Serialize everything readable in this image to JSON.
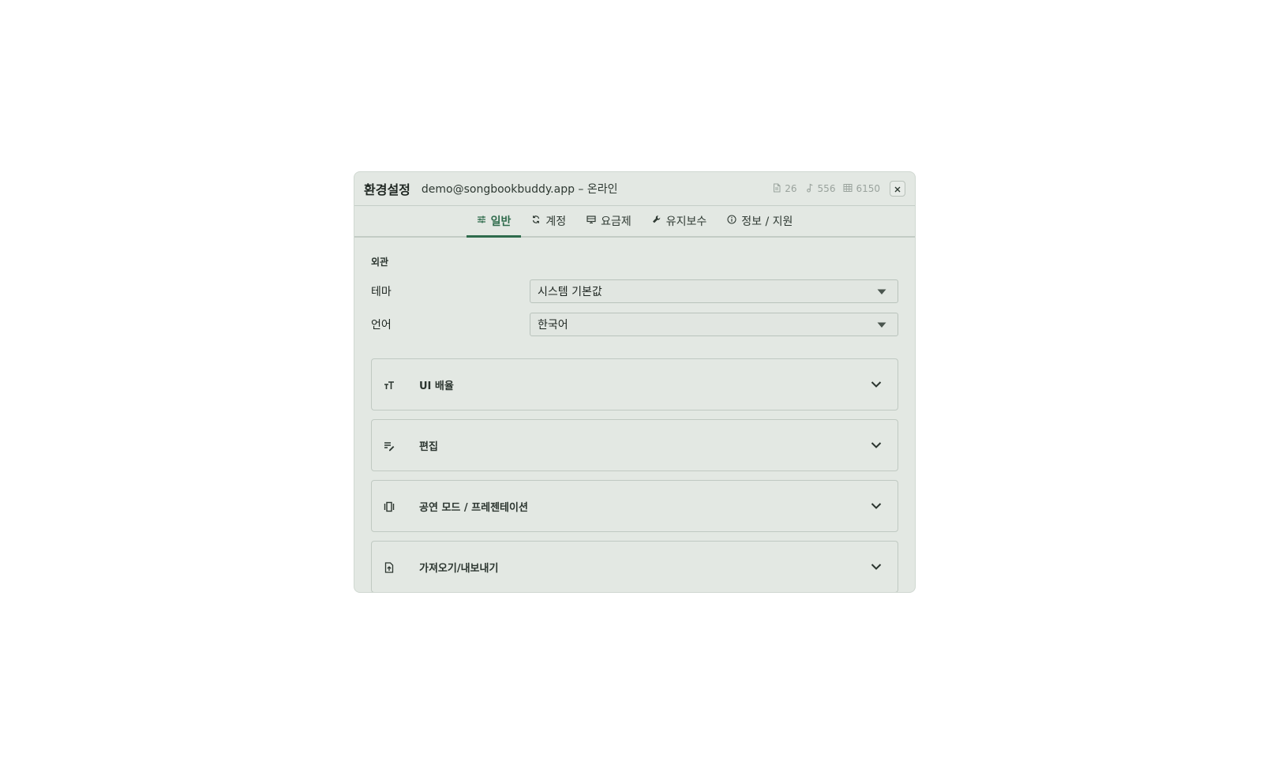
{
  "dialog": {
    "title": "환경설정",
    "subtitle": "demo@songbookbuddy.app – 온라인",
    "stats": [
      {
        "icon": "document-icon",
        "value": "26"
      },
      {
        "icon": "music-note-icon",
        "value": "556"
      },
      {
        "icon": "grid-icon",
        "value": "6150"
      }
    ]
  },
  "tabs": [
    {
      "label": "일반",
      "icon": "sliders-icon",
      "active": true
    },
    {
      "label": "계정",
      "icon": "sync-icon",
      "active": false
    },
    {
      "label": "요금제",
      "icon": "monitor-icon",
      "active": false
    },
    {
      "label": "유지보수",
      "icon": "wrench-icon",
      "active": false
    },
    {
      "label": "정보 / 지원",
      "icon": "info-icon",
      "active": false
    }
  ],
  "appearance": {
    "section_title": "외관",
    "theme_label": "테마",
    "theme_value": "시스템 기본값",
    "language_label": "언어",
    "language_value": "한국어"
  },
  "panels": [
    {
      "label": "UI 배율",
      "icon": "text-size-icon"
    },
    {
      "label": "편집",
      "icon": "edit-lines-icon"
    },
    {
      "label": "공연 모드 / 프레젠테이션",
      "icon": "presentation-icon"
    },
    {
      "label": "가져오기/내보내기",
      "icon": "file-import-icon"
    }
  ],
  "colors": {
    "accent": "#2f6b4c",
    "dialog_bg": "#e3e8e3"
  }
}
